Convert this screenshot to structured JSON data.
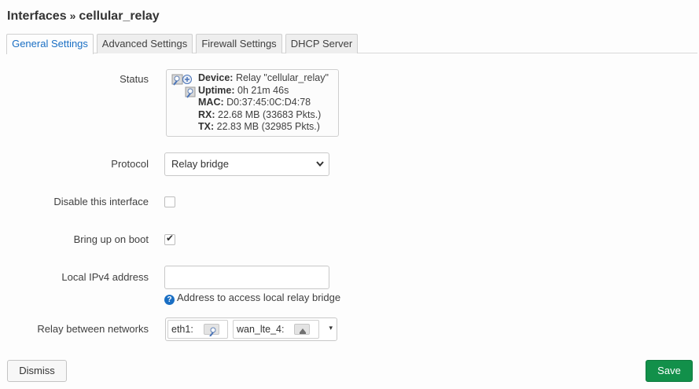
{
  "title": {
    "section": "Interfaces",
    "separator": "»",
    "name": "cellular_relay"
  },
  "tabs": [
    {
      "label": "General Settings",
      "active": true
    },
    {
      "label": "Advanced Settings",
      "active": false
    },
    {
      "label": "Firewall Settings",
      "active": false
    },
    {
      "label": "DHCP Server",
      "active": false
    }
  ],
  "form": {
    "status": {
      "label": "Status",
      "device_key": "Device:",
      "device_val": "Relay \"cellular_relay\"",
      "uptime_key": "Uptime:",
      "uptime_val": "0h 21m 46s",
      "mac_key": "MAC:",
      "mac_val": "D0:37:45:0C:D4:78",
      "rx_key": "RX:",
      "rx_val": "22.68 MB (33683 Pkts.)",
      "tx_key": "TX:",
      "tx_val": "22.83 MB (32985 Pkts.)"
    },
    "protocol": {
      "label": "Protocol",
      "value": "Relay bridge"
    },
    "disable": {
      "label": "Disable this interface",
      "checked": false
    },
    "boot": {
      "label": "Bring up on boot",
      "checked": true,
      "tick": "✔"
    },
    "ipv4": {
      "label": "Local IPv4 address",
      "value": "",
      "hint": "Address to access local relay bridge",
      "hint_icon": "?"
    },
    "relay": {
      "label": "Relay between networks",
      "networks": [
        {
          "name": "eth1:",
          "icon": "ethernet-port-icon"
        },
        {
          "name": "wan_lte_4:",
          "icon": "modem-icon"
        }
      ]
    }
  },
  "buttons": {
    "dismiss": "Dismiss",
    "save": "Save"
  },
  "colors": {
    "accent": "#1a6fc4",
    "save": "#12904a"
  }
}
